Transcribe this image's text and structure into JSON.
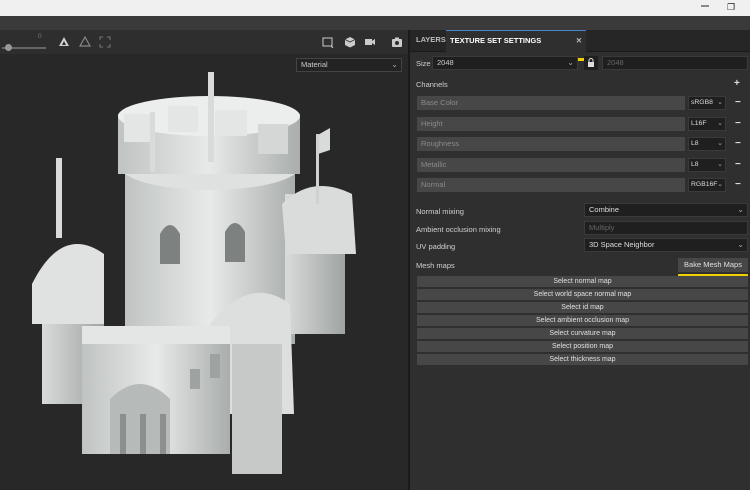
{
  "window": {
    "restore_glyph": "❐"
  },
  "viewport": {
    "slider_value": "0",
    "material_select": "Material",
    "icons": [
      "triangle-icon",
      "triangle-outline-icon",
      "fit-icon",
      "frame-icon",
      "cube-icon",
      "camera-icon",
      "screenshot-icon"
    ]
  },
  "panel": {
    "tabs": [
      {
        "label": "LAYERS",
        "active": false
      },
      {
        "label": "TEXTURE SET SETTINGS",
        "active": true
      }
    ],
    "tab_close": "✕",
    "size": {
      "label": "Size",
      "value": "2048",
      "linked_value": "2048"
    },
    "channels_label": "Channels",
    "channels": [
      {
        "name": "Base Color",
        "format": "sRGB8"
      },
      {
        "name": "Height",
        "format": "L16F"
      },
      {
        "name": "Roughness",
        "format": "L8"
      },
      {
        "name": "Metallic",
        "format": "L8"
      },
      {
        "name": "Normal",
        "format": "RGB16F"
      }
    ],
    "settings": {
      "normal_mixing": {
        "label": "Normal mixing",
        "value": "Combine"
      },
      "ao_mixing": {
        "label": "Ambient occlusion mixing",
        "value": "Multiply"
      },
      "uv_padding": {
        "label": "UV padding",
        "value": "3D Space Neighbor"
      }
    },
    "mesh_maps_label": "Mesh maps",
    "bake_button": "Bake Mesh Maps",
    "mesh_maps": [
      "Select normal map",
      "Select world space normal map",
      "Select id map",
      "Select ambient occlusion map",
      "Select curvature map",
      "Select position map",
      "Select thickness map"
    ]
  },
  "accent_colors": {
    "highlight": "#f0d000",
    "tab_border": "#4a86c8"
  }
}
